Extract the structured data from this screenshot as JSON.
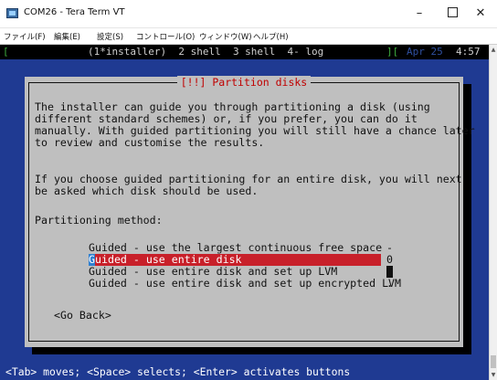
{
  "window": {
    "title": "COM26 - Tera Term VT",
    "minimize": "–",
    "close": "✕"
  },
  "menu": [
    "ファイル(F)",
    "編集(E)",
    "設定(S)",
    "コントロール(O)",
    "ウィンドウ(W)",
    "ヘルプ(H)"
  ],
  "statusbar": {
    "left_bracket": "[",
    "windows": "(1*installer)  2 shell  3 shell  4- log",
    "right_bracket": "][",
    "date": "Apr 25",
    "time": "4:57"
  },
  "dialog": {
    "title": "[!!] Partition disks",
    "paragraph1": [
      "The installer can guide you through partitioning a disk (using",
      "different standard schemes) or, if you prefer, you can do it",
      "manually. With guided partitioning you will still have a chance later",
      "to review and customise the results."
    ],
    "paragraph2": [
      "If you choose guided partitioning for an entire disk, you will next",
      "be asked which disk should be used."
    ],
    "method_label": "Partitioning method:",
    "options": [
      "Guided - use the largest continuous free space",
      "Guided - use entire disk",
      "Guided - use entire disk and set up LVM",
      "Guided - use entire disk and set up encrypted LVM"
    ],
    "selected_first_char": "G",
    "selected_rest": "uided - use entire disk",
    "scroll_indicators": [
      "-",
      "0",
      "",
      "."
    ],
    "go_back": "<Go Back>"
  },
  "help_line": "<Tab> moves; <Space> selects; <Enter> activates buttons",
  "colors": {
    "terminal_bg": "#1f3a92",
    "dialog_bg": "#bfbfbf",
    "selection": "#c8202a",
    "title_red": "#c00000"
  }
}
